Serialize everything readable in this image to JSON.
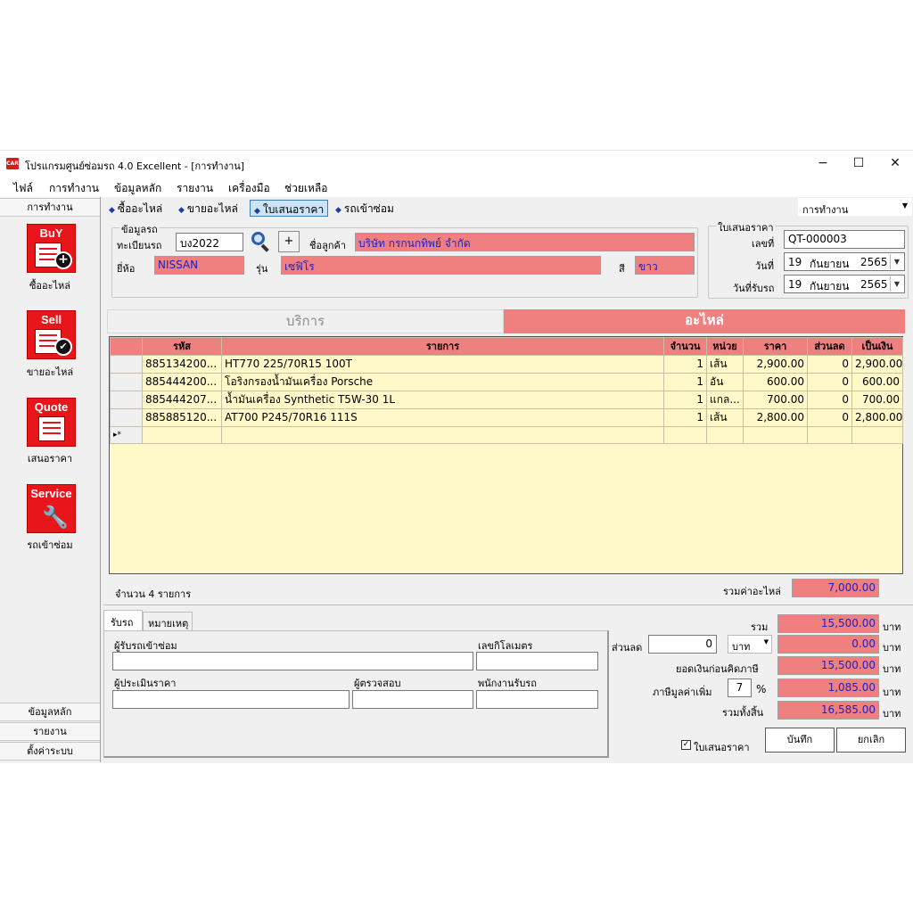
{
  "window": {
    "title": "โปรแกรมศูนย์ซ่อมรถ 4.0 Excellent - [การทำงาน]",
    "logo_text": "CAR",
    "minimize": "−",
    "maximize": "☐",
    "close": "✕"
  },
  "menu": [
    "ไฟล์",
    "การทำงาน",
    "ข้อมูลหลัก",
    "รายงาน",
    "เครื่องมือ",
    "ช่วยเหลือ"
  ],
  "leftnav": {
    "header": "การทำงาน",
    "items": [
      {
        "icon_text": "BuY",
        "label": "ซื้ออะไหล่",
        "icon": "buy-icon"
      },
      {
        "icon_text": "Sell",
        "label": "ขายอะไหล่",
        "icon": "sell-icon"
      },
      {
        "icon_text": "Quote",
        "label": "เสนอราคา",
        "icon": "quote-icon"
      },
      {
        "icon_text": "Service",
        "label": "รถเข้าซ่อม",
        "icon": "service-icon"
      }
    ],
    "footer": [
      "ข้อมูลหลัก",
      "รายงาน",
      "ตั้งค่าระบบ"
    ]
  },
  "toolbar": {
    "tabs": [
      "ซื้ออะไหล่",
      "ขายอะไหล่",
      "ใบเสนอราคา",
      "รถเข้าซ่อม"
    ],
    "selected": 2,
    "combo_value": "การทำงาน",
    "accent": "#3c7fb1"
  },
  "car": {
    "group_label": "ข้อมูลรถ",
    "plate_label": "ทะเบียนรถ",
    "plate_value": "บง2022",
    "add_button": "+",
    "customer_label": "ชื่อลูกค้า",
    "customer_value": "บริษัท กรกนกทิพย์ จำกัด",
    "brand_label": "ยี่ห้อ",
    "brand_value": "NISSAN",
    "model_label": "รุ่น",
    "model_value": "เซฟิโร",
    "color_label": "สี",
    "color_value": "ขาว"
  },
  "quote": {
    "group_label": "ใบเสนอราคา",
    "number_label": "เลขที่",
    "number_value": "QT-000003",
    "date_label": "วันที่",
    "date_day": "19",
    "date_month": "กันยายน",
    "date_year": "2565",
    "recv_label": "วันที่รับรถ",
    "recv_day": "19",
    "recv_month": "กันยายน",
    "recv_year": "2565"
  },
  "tabs": {
    "service": "บริการ",
    "parts": "อะไหล่",
    "highlight": "#f08080"
  },
  "grid": {
    "columns": [
      "รหัส",
      "รายการ",
      "จำนวน",
      "หน่วย",
      "ราคา",
      "ส่วนลด",
      "เป็นเงิน"
    ],
    "rows": [
      [
        "885134200...",
        "HT770 225/70R15 100T",
        "1",
        "เส้น",
        "2,900.00",
        "0",
        "2,900.00"
      ],
      [
        "885444200...",
        "โอริงกรองน้ำมันเครื่อง Porsche",
        "1",
        "อัน",
        "600.00",
        "0",
        "600.00"
      ],
      [
        "885444207...",
        "น้ำมันเครื่อง Synthetic T5W-30 1L",
        "1",
        "แกล...",
        "700.00",
        "0",
        "700.00"
      ],
      [
        "885885120...",
        "AT700 P245/70R16 111S",
        "1",
        "เส้น",
        "2,800.00",
        "0",
        "2,800.00"
      ]
    ],
    "new_row_marker": "▸*",
    "count_text": "จำนวน 4 รายการ",
    "parts_total_label": "รวมค่าอะไหล่",
    "parts_total_value": "7,000.00"
  },
  "bottom": {
    "tab1": "รับรถ",
    "tab2": "หมายเหตุ",
    "receiver_label": "ผู้รับรถเข้าซ่อม",
    "mileage_label": "เลขกิโลเมตร",
    "estimator_label": "ผู้ประเมินราคา",
    "inspector_label": "ผู้ตรวจสอบ",
    "staff_label": "พนักงานรับรถ"
  },
  "totals": {
    "sum_label": "รวม",
    "sum_value": "15,500.00",
    "discount_label": "ส่วนลด",
    "discount_input": "0",
    "discount_unit": "บาท",
    "discount_value": "0.00",
    "pretax_label": "ยอดเงินก่อนคิดภาษี",
    "pretax_value": "15,500.00",
    "vat_label": "ภาษีมูลค่าเพิ่ม",
    "vat_rate": "7",
    "vat_pct": "%",
    "vat_value": "1,085.00",
    "grand_label": "รวมทั้งสิ้น",
    "grand_value": "16,585.00",
    "baht": "บาท"
  },
  "actions": {
    "print_checkbox_label": "ใบเสนอราคา",
    "checkmark": "✓",
    "save": "บันทึก",
    "cancel": "ยกเลิก"
  }
}
